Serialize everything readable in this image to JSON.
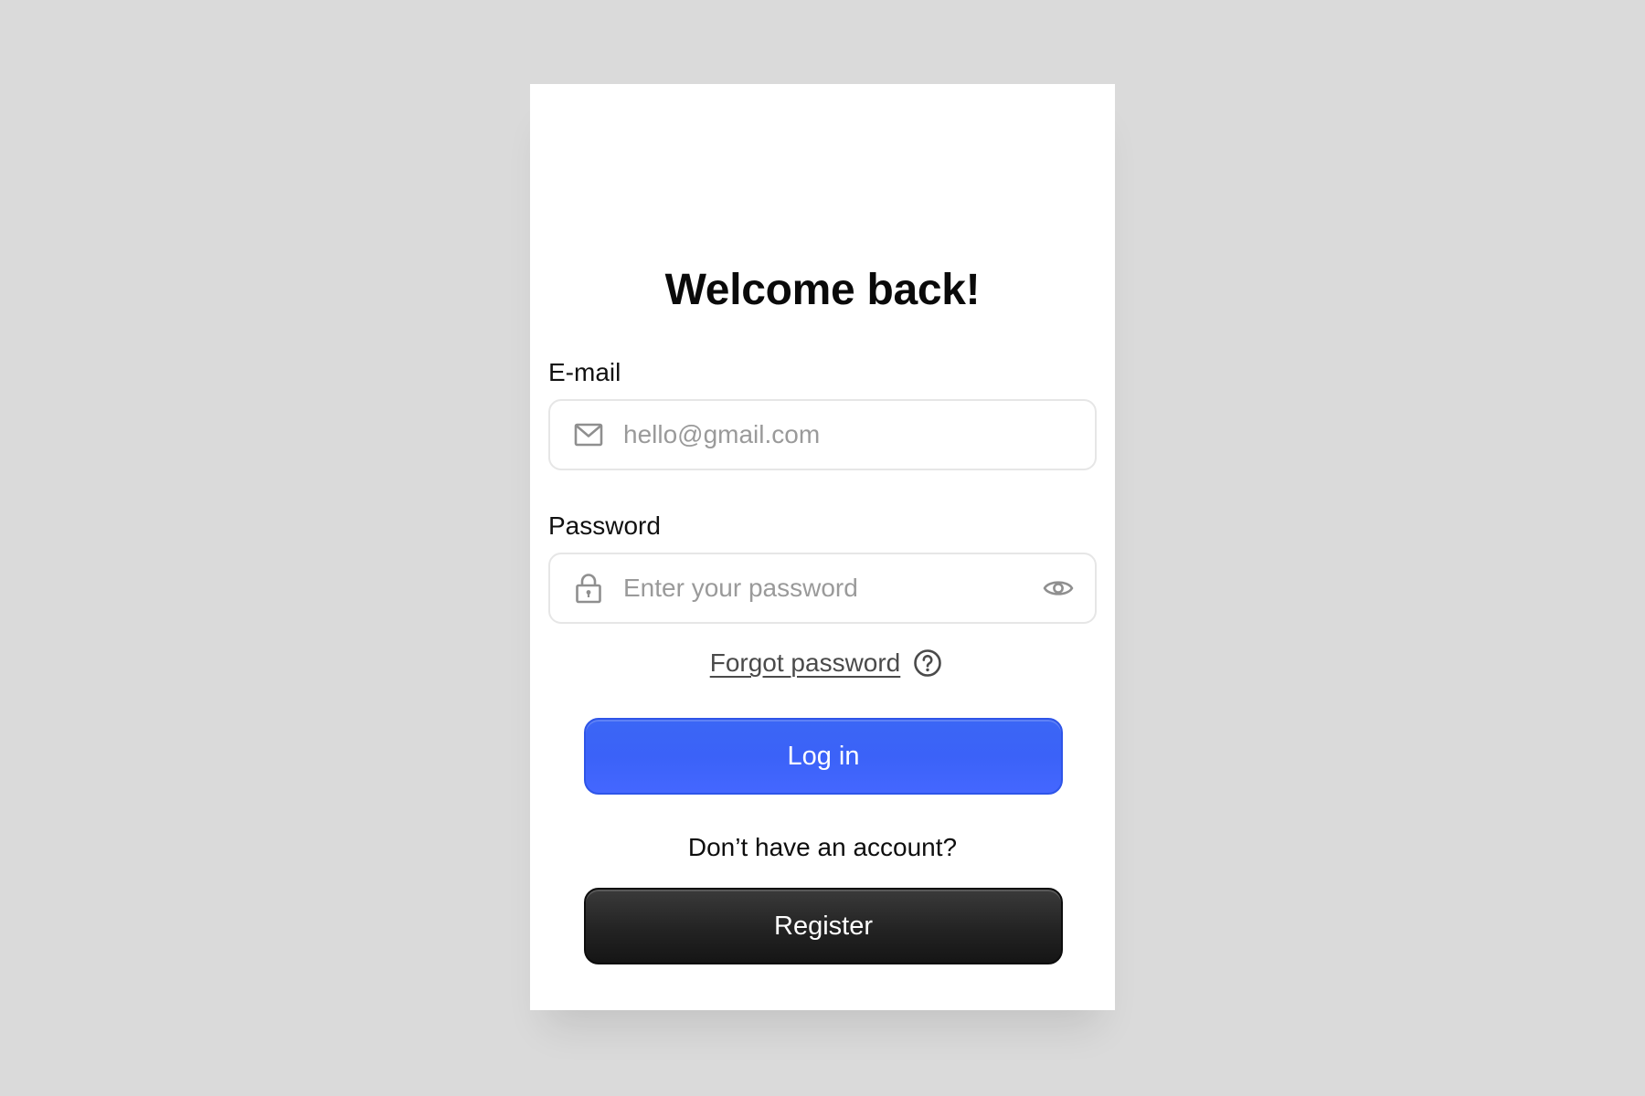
{
  "page": {
    "background_color": "#dadada",
    "card_color": "#ffffff"
  },
  "login": {
    "title": "Welcome back!",
    "email": {
      "label": "E-mail",
      "placeholder": "hello@gmail.com",
      "icon": "mail-icon"
    },
    "password": {
      "label": "Password",
      "placeholder": "Enter your password",
      "icon": "lock-icon",
      "toggle_icon": "eye-icon"
    },
    "forgot": {
      "label": "Forgot password",
      "icon": "help-circle-icon"
    },
    "login_button": {
      "label": "Log in",
      "color": "#3f63fa"
    },
    "no_account_text": "Don’t have an account?",
    "register_button": {
      "label": "Register",
      "color": "#1f1f1f"
    }
  }
}
